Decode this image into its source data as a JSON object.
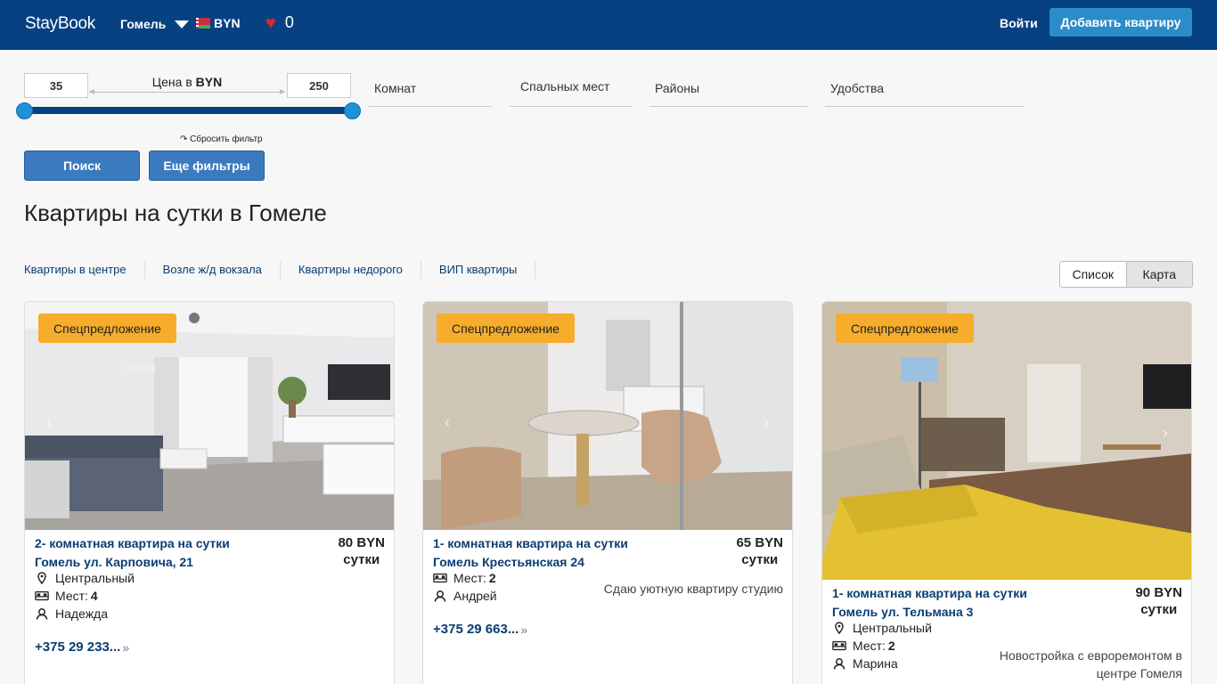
{
  "header": {
    "logo": "StayBook",
    "city": "Гомель",
    "currency": "BYN",
    "favorites_count": "0",
    "login": "Войти",
    "add_apartment": "Добавить квартиру"
  },
  "filters": {
    "price_min": "35",
    "price_max": "250",
    "price_label_prefix": "Цена в",
    "price_label_currency": "BYN",
    "rooms": "Комнат",
    "sleeping_places": "Спальных мест",
    "districts": "Районы",
    "amenities": "Удобства",
    "reset": "Сбросить фильтр",
    "search": "Поиск",
    "more_filters": "Еще фильтры",
    "price_range_fraction": [
      0,
      1
    ]
  },
  "page_title": "Квартиры на сутки в Гомеле",
  "quick_links": [
    "Квартиры в центре",
    "Возле ж/д вокзала",
    "Квартиры недорого",
    "ВИП квартиры"
  ],
  "view_toggle": {
    "list": "Список",
    "map": "Карта",
    "active": "list"
  },
  "cards": [
    {
      "badge": "Спецпредложение",
      "title_line1": "2- комнатная квартира на сутки",
      "title_line2": "Гомель ул. Карповича, 21",
      "price": "80 BYN",
      "price_unit": "сутки",
      "district": "Центральный",
      "places_label": "Мест:",
      "places": "4",
      "host": "Надежда",
      "phone": "+375 29 233..."
    },
    {
      "badge": "Спецпредложение",
      "title_line1": "1- комнатная квартира на сутки",
      "title_line2": "Гомель Крестьянская 24",
      "price": "65 BYN",
      "price_unit": "сутки",
      "places_label": "Мест:",
      "places": "2",
      "host": "Андрей",
      "description": "Сдаю уютную квартиру студию",
      "phone": "+375 29 663..."
    },
    {
      "badge": "Спецпредложение",
      "title_line1": "1- комнатная квартира на сутки",
      "title_line2": "Гомель ул. Тельмана 3",
      "price": "90 BYN",
      "price_unit": "сутки",
      "district": "Центральный",
      "places_label": "Мест:",
      "places": "2",
      "host": "Марина",
      "description_line1": "Новостройка с евроремонтом в",
      "description_line2": "центре Гомеля"
    }
  ],
  "colors": {
    "header_bg": "#074182",
    "accent_button": "#2a8cc9",
    "badge": "#f6ad2c",
    "link": "#0a3d73",
    "slider_thumb": "#1f8fd8"
  }
}
